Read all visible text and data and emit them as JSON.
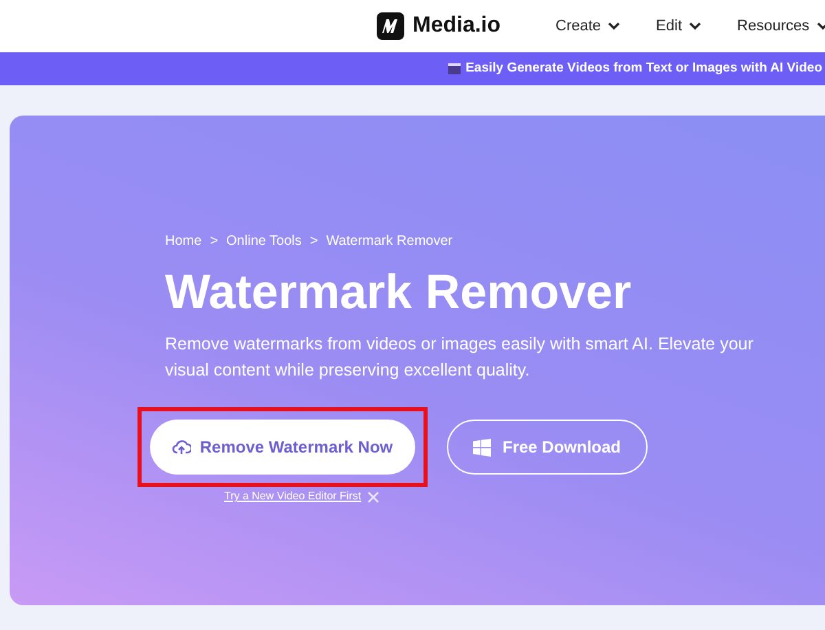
{
  "header": {
    "brand": "Media.io",
    "nav": [
      {
        "label": "Create"
      },
      {
        "label": "Edit"
      },
      {
        "label": "Resources"
      }
    ]
  },
  "banner": {
    "text": "Easily Generate Videos from Text or Images with AI Video"
  },
  "hero": {
    "breadcrumb": [
      "Home",
      "Online Tools",
      "Watermark Remover"
    ],
    "separator": ">",
    "title": "Watermark Remover",
    "description": "Remove watermarks from videos or images easily with smart AI. Elevate your visual content while preserving excellent quality.",
    "primary_button": "Remove Watermark Now",
    "secondary_button": "Free Download",
    "link": "Try a New Video Editor First"
  }
}
